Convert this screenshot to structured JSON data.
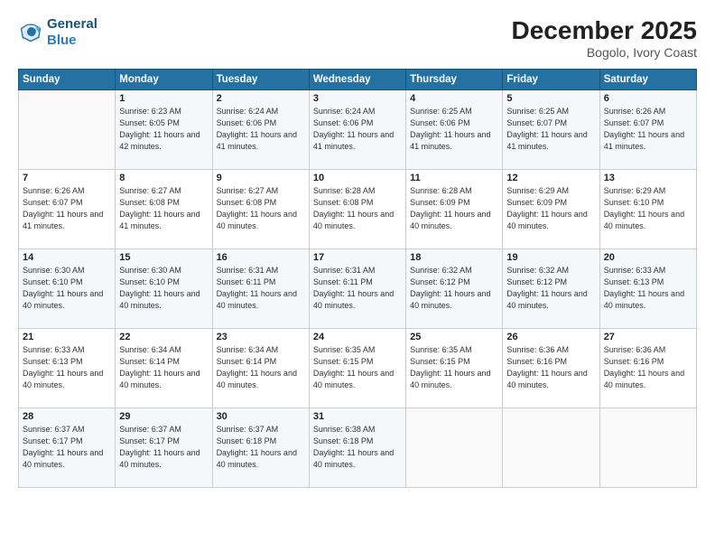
{
  "header": {
    "logo_line1": "General",
    "logo_line2": "Blue",
    "month": "December 2025",
    "location": "Bogolo, Ivory Coast"
  },
  "weekdays": [
    "Sunday",
    "Monday",
    "Tuesday",
    "Wednesday",
    "Thursday",
    "Friday",
    "Saturday"
  ],
  "weeks": [
    [
      {
        "day": "",
        "sunrise": "",
        "sunset": "",
        "daylight": ""
      },
      {
        "day": "1",
        "sunrise": "Sunrise: 6:23 AM",
        "sunset": "Sunset: 6:05 PM",
        "daylight": "Daylight: 11 hours and 42 minutes."
      },
      {
        "day": "2",
        "sunrise": "Sunrise: 6:24 AM",
        "sunset": "Sunset: 6:06 PM",
        "daylight": "Daylight: 11 hours and 41 minutes."
      },
      {
        "day": "3",
        "sunrise": "Sunrise: 6:24 AM",
        "sunset": "Sunset: 6:06 PM",
        "daylight": "Daylight: 11 hours and 41 minutes."
      },
      {
        "day": "4",
        "sunrise": "Sunrise: 6:25 AM",
        "sunset": "Sunset: 6:06 PM",
        "daylight": "Daylight: 11 hours and 41 minutes."
      },
      {
        "day": "5",
        "sunrise": "Sunrise: 6:25 AM",
        "sunset": "Sunset: 6:07 PM",
        "daylight": "Daylight: 11 hours and 41 minutes."
      },
      {
        "day": "6",
        "sunrise": "Sunrise: 6:26 AM",
        "sunset": "Sunset: 6:07 PM",
        "daylight": "Daylight: 11 hours and 41 minutes."
      }
    ],
    [
      {
        "day": "7",
        "sunrise": "Sunrise: 6:26 AM",
        "sunset": "Sunset: 6:07 PM",
        "daylight": "Daylight: 11 hours and 41 minutes."
      },
      {
        "day": "8",
        "sunrise": "Sunrise: 6:27 AM",
        "sunset": "Sunset: 6:08 PM",
        "daylight": "Daylight: 11 hours and 41 minutes."
      },
      {
        "day": "9",
        "sunrise": "Sunrise: 6:27 AM",
        "sunset": "Sunset: 6:08 PM",
        "daylight": "Daylight: 11 hours and 40 minutes."
      },
      {
        "day": "10",
        "sunrise": "Sunrise: 6:28 AM",
        "sunset": "Sunset: 6:08 PM",
        "daylight": "Daylight: 11 hours and 40 minutes."
      },
      {
        "day": "11",
        "sunrise": "Sunrise: 6:28 AM",
        "sunset": "Sunset: 6:09 PM",
        "daylight": "Daylight: 11 hours and 40 minutes."
      },
      {
        "day": "12",
        "sunrise": "Sunrise: 6:29 AM",
        "sunset": "Sunset: 6:09 PM",
        "daylight": "Daylight: 11 hours and 40 minutes."
      },
      {
        "day": "13",
        "sunrise": "Sunrise: 6:29 AM",
        "sunset": "Sunset: 6:10 PM",
        "daylight": "Daylight: 11 hours and 40 minutes."
      }
    ],
    [
      {
        "day": "14",
        "sunrise": "Sunrise: 6:30 AM",
        "sunset": "Sunset: 6:10 PM",
        "daylight": "Daylight: 11 hours and 40 minutes."
      },
      {
        "day": "15",
        "sunrise": "Sunrise: 6:30 AM",
        "sunset": "Sunset: 6:10 PM",
        "daylight": "Daylight: 11 hours and 40 minutes."
      },
      {
        "day": "16",
        "sunrise": "Sunrise: 6:31 AM",
        "sunset": "Sunset: 6:11 PM",
        "daylight": "Daylight: 11 hours and 40 minutes."
      },
      {
        "day": "17",
        "sunrise": "Sunrise: 6:31 AM",
        "sunset": "Sunset: 6:11 PM",
        "daylight": "Daylight: 11 hours and 40 minutes."
      },
      {
        "day": "18",
        "sunrise": "Sunrise: 6:32 AM",
        "sunset": "Sunset: 6:12 PM",
        "daylight": "Daylight: 11 hours and 40 minutes."
      },
      {
        "day": "19",
        "sunrise": "Sunrise: 6:32 AM",
        "sunset": "Sunset: 6:12 PM",
        "daylight": "Daylight: 11 hours and 40 minutes."
      },
      {
        "day": "20",
        "sunrise": "Sunrise: 6:33 AM",
        "sunset": "Sunset: 6:13 PM",
        "daylight": "Daylight: 11 hours and 40 minutes."
      }
    ],
    [
      {
        "day": "21",
        "sunrise": "Sunrise: 6:33 AM",
        "sunset": "Sunset: 6:13 PM",
        "daylight": "Daylight: 11 hours and 40 minutes."
      },
      {
        "day": "22",
        "sunrise": "Sunrise: 6:34 AM",
        "sunset": "Sunset: 6:14 PM",
        "daylight": "Daylight: 11 hours and 40 minutes."
      },
      {
        "day": "23",
        "sunrise": "Sunrise: 6:34 AM",
        "sunset": "Sunset: 6:14 PM",
        "daylight": "Daylight: 11 hours and 40 minutes."
      },
      {
        "day": "24",
        "sunrise": "Sunrise: 6:35 AM",
        "sunset": "Sunset: 6:15 PM",
        "daylight": "Daylight: 11 hours and 40 minutes."
      },
      {
        "day": "25",
        "sunrise": "Sunrise: 6:35 AM",
        "sunset": "Sunset: 6:15 PM",
        "daylight": "Daylight: 11 hours and 40 minutes."
      },
      {
        "day": "26",
        "sunrise": "Sunrise: 6:36 AM",
        "sunset": "Sunset: 6:16 PM",
        "daylight": "Daylight: 11 hours and 40 minutes."
      },
      {
        "day": "27",
        "sunrise": "Sunrise: 6:36 AM",
        "sunset": "Sunset: 6:16 PM",
        "daylight": "Daylight: 11 hours and 40 minutes."
      }
    ],
    [
      {
        "day": "28",
        "sunrise": "Sunrise: 6:37 AM",
        "sunset": "Sunset: 6:17 PM",
        "daylight": "Daylight: 11 hours and 40 minutes."
      },
      {
        "day": "29",
        "sunrise": "Sunrise: 6:37 AM",
        "sunset": "Sunset: 6:17 PM",
        "daylight": "Daylight: 11 hours and 40 minutes."
      },
      {
        "day": "30",
        "sunrise": "Sunrise: 6:37 AM",
        "sunset": "Sunset: 6:18 PM",
        "daylight": "Daylight: 11 hours and 40 minutes."
      },
      {
        "day": "31",
        "sunrise": "Sunrise: 6:38 AM",
        "sunset": "Sunset: 6:18 PM",
        "daylight": "Daylight: 11 hours and 40 minutes."
      },
      {
        "day": "",
        "sunrise": "",
        "sunset": "",
        "daylight": ""
      },
      {
        "day": "",
        "sunrise": "",
        "sunset": "",
        "daylight": ""
      },
      {
        "day": "",
        "sunrise": "",
        "sunset": "",
        "daylight": ""
      }
    ]
  ]
}
